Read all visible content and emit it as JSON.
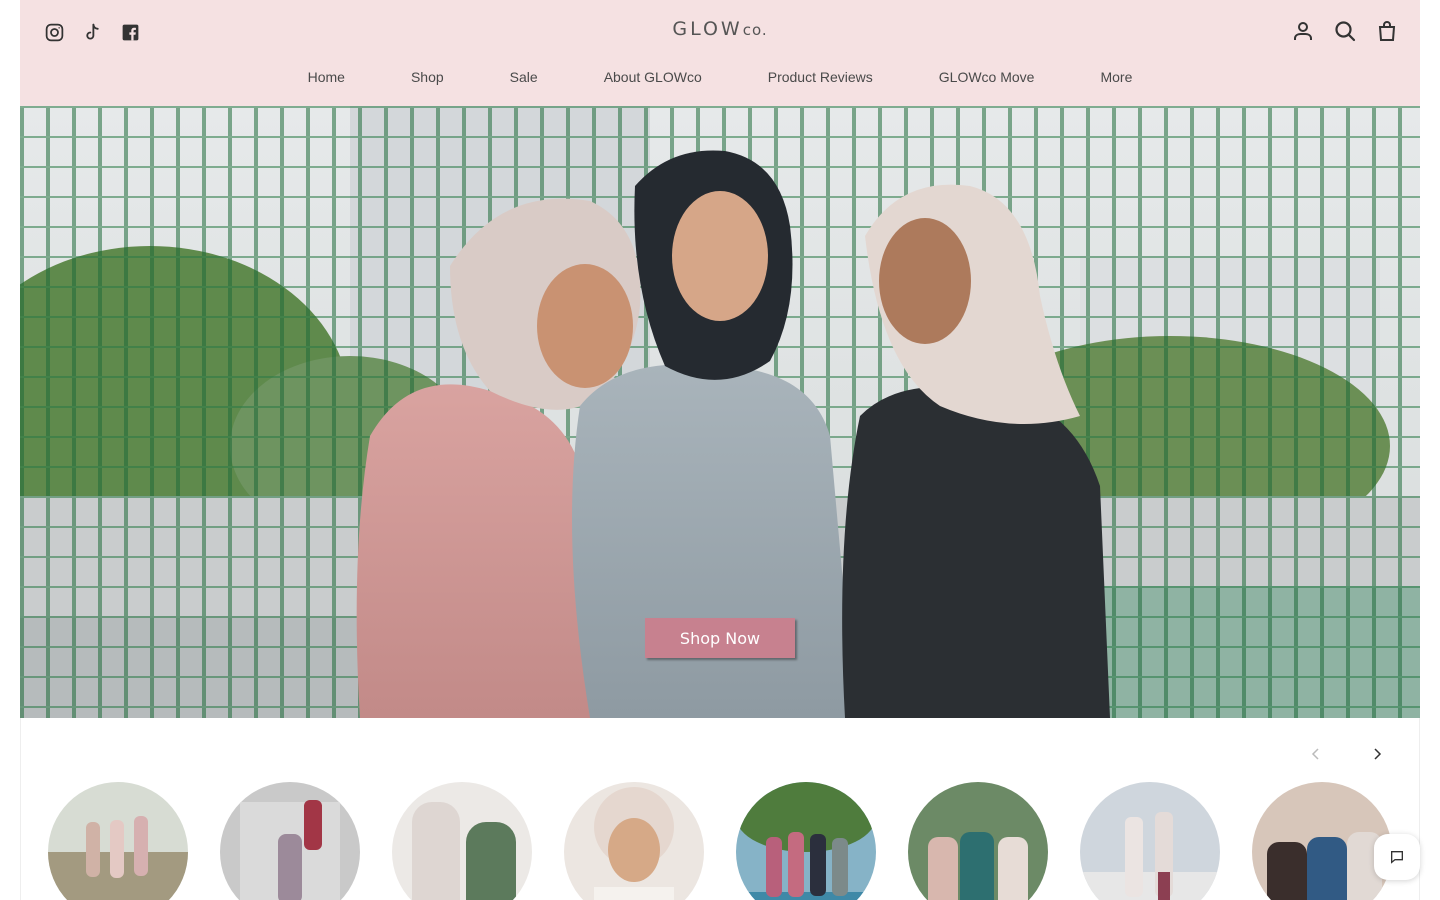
{
  "header": {
    "logo_main": "GLOW",
    "logo_suffix": "co.",
    "social": [
      {
        "icon": "instagram-icon"
      },
      {
        "icon": "tiktok-icon"
      },
      {
        "icon": "facebook-icon"
      }
    ],
    "actions": [
      {
        "icon": "account-icon"
      },
      {
        "icon": "search-icon"
      },
      {
        "icon": "shopping-bag-icon"
      }
    ],
    "background": "#f5e1e2"
  },
  "nav": {
    "items": [
      {
        "label": "Home"
      },
      {
        "label": "Shop"
      },
      {
        "label": "Sale"
      },
      {
        "label": "About GLOWco"
      },
      {
        "label": "Product Reviews"
      },
      {
        "label": "GLOWco Move"
      },
      {
        "label": "More"
      }
    ]
  },
  "hero": {
    "cta_label": "Shop Now",
    "cta_color": "#c7818f"
  },
  "carousel": {
    "prev_icon": "chevron-left-icon",
    "next_icon": "chevron-right-icon",
    "item_count": 8
  },
  "chat": {
    "icon": "chat-bubble-icon"
  }
}
